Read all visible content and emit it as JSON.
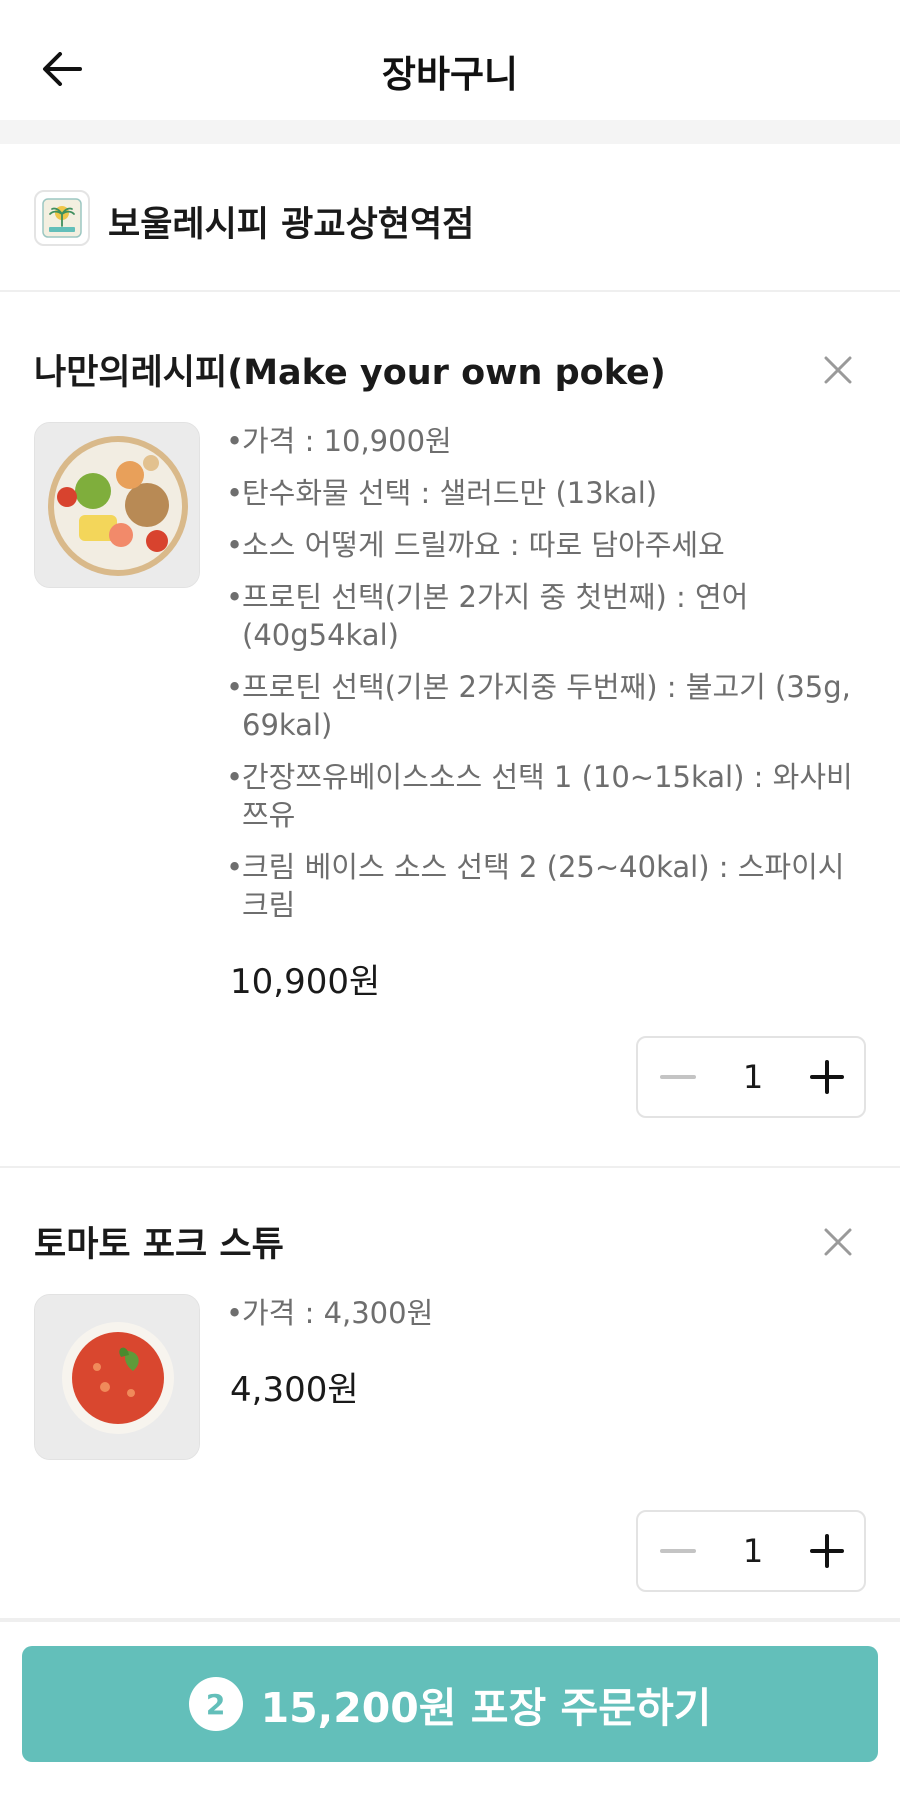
{
  "header": {
    "title": "장바구니",
    "back_icon": "arrow-left-icon"
  },
  "store": {
    "name": "보울레시피 광교상현역점",
    "logo_icon": "store-logo-icon"
  },
  "items": [
    {
      "title": "나만의레시피(Make your own poke)",
      "options": [
        "가격 : 10,900원",
        "탄수화물 선택 : 샐러드만 (13kal)",
        "소스 어떻게 드릴까요 : 따로 담아주세요",
        "프로틴 선택(기본 2가지 중 첫번째) : 연어 (40g54kal)",
        "프로틴 선택(기본 2가지중 두번째) : 불고기 (35g, 69kal)",
        "간장쯔유베이스소스 선택 1 (10~15kal) : 와사비 쯔유",
        "크림 베이스 소스 선택 2 (25~40kal) : 스파이시 크림"
      ],
      "price": "10,900원",
      "quantity": "1"
    },
    {
      "title": "토마토 포크 스튜",
      "options": [
        "가격 : 4,300원"
      ],
      "price": "4,300원",
      "quantity": "1"
    }
  ],
  "footer": {
    "count": "2",
    "order_label": "15,200원 포장 주문하기"
  },
  "colors": {
    "accent": "#63bfba",
    "muted": "#6e6e6e",
    "divider": "#efefef"
  }
}
